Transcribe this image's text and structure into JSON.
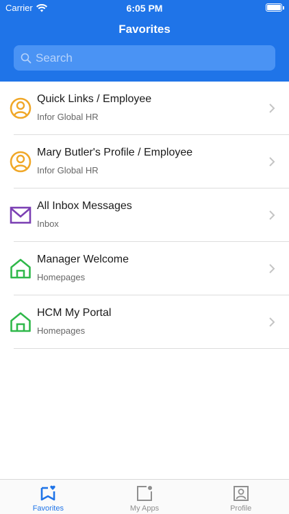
{
  "status_bar": {
    "carrier": "Carrier",
    "time": "6:05 PM"
  },
  "nav": {
    "title": "Favorites"
  },
  "search": {
    "placeholder": "Search",
    "value": ""
  },
  "colors": {
    "brand": "#1f74e8",
    "person_icon": "#f0a727",
    "inbox_icon": "#7b3fb3",
    "home_icon": "#2fb84a"
  },
  "favorites": [
    {
      "title": "Quick Links / Employee",
      "subtitle": "Infor Global HR",
      "icon": "person-circle-icon"
    },
    {
      "title": "Mary Butler's Profile / Employee",
      "subtitle": "Infor Global HR",
      "icon": "person-circle-icon"
    },
    {
      "title": "All Inbox Messages",
      "subtitle": "Inbox",
      "icon": "envelope-icon"
    },
    {
      "title": "Manager Welcome",
      "subtitle": "Homepages",
      "icon": "home-icon"
    },
    {
      "title": "HCM My Portal",
      "subtitle": "Homepages",
      "icon": "home-icon"
    }
  ],
  "tabbar": {
    "tabs": [
      {
        "label": "Favorites",
        "icon": "favorites-icon",
        "active": true
      },
      {
        "label": "My Apps",
        "icon": "apps-icon",
        "active": false
      },
      {
        "label": "Profile",
        "icon": "profile-icon",
        "active": false
      }
    ]
  }
}
